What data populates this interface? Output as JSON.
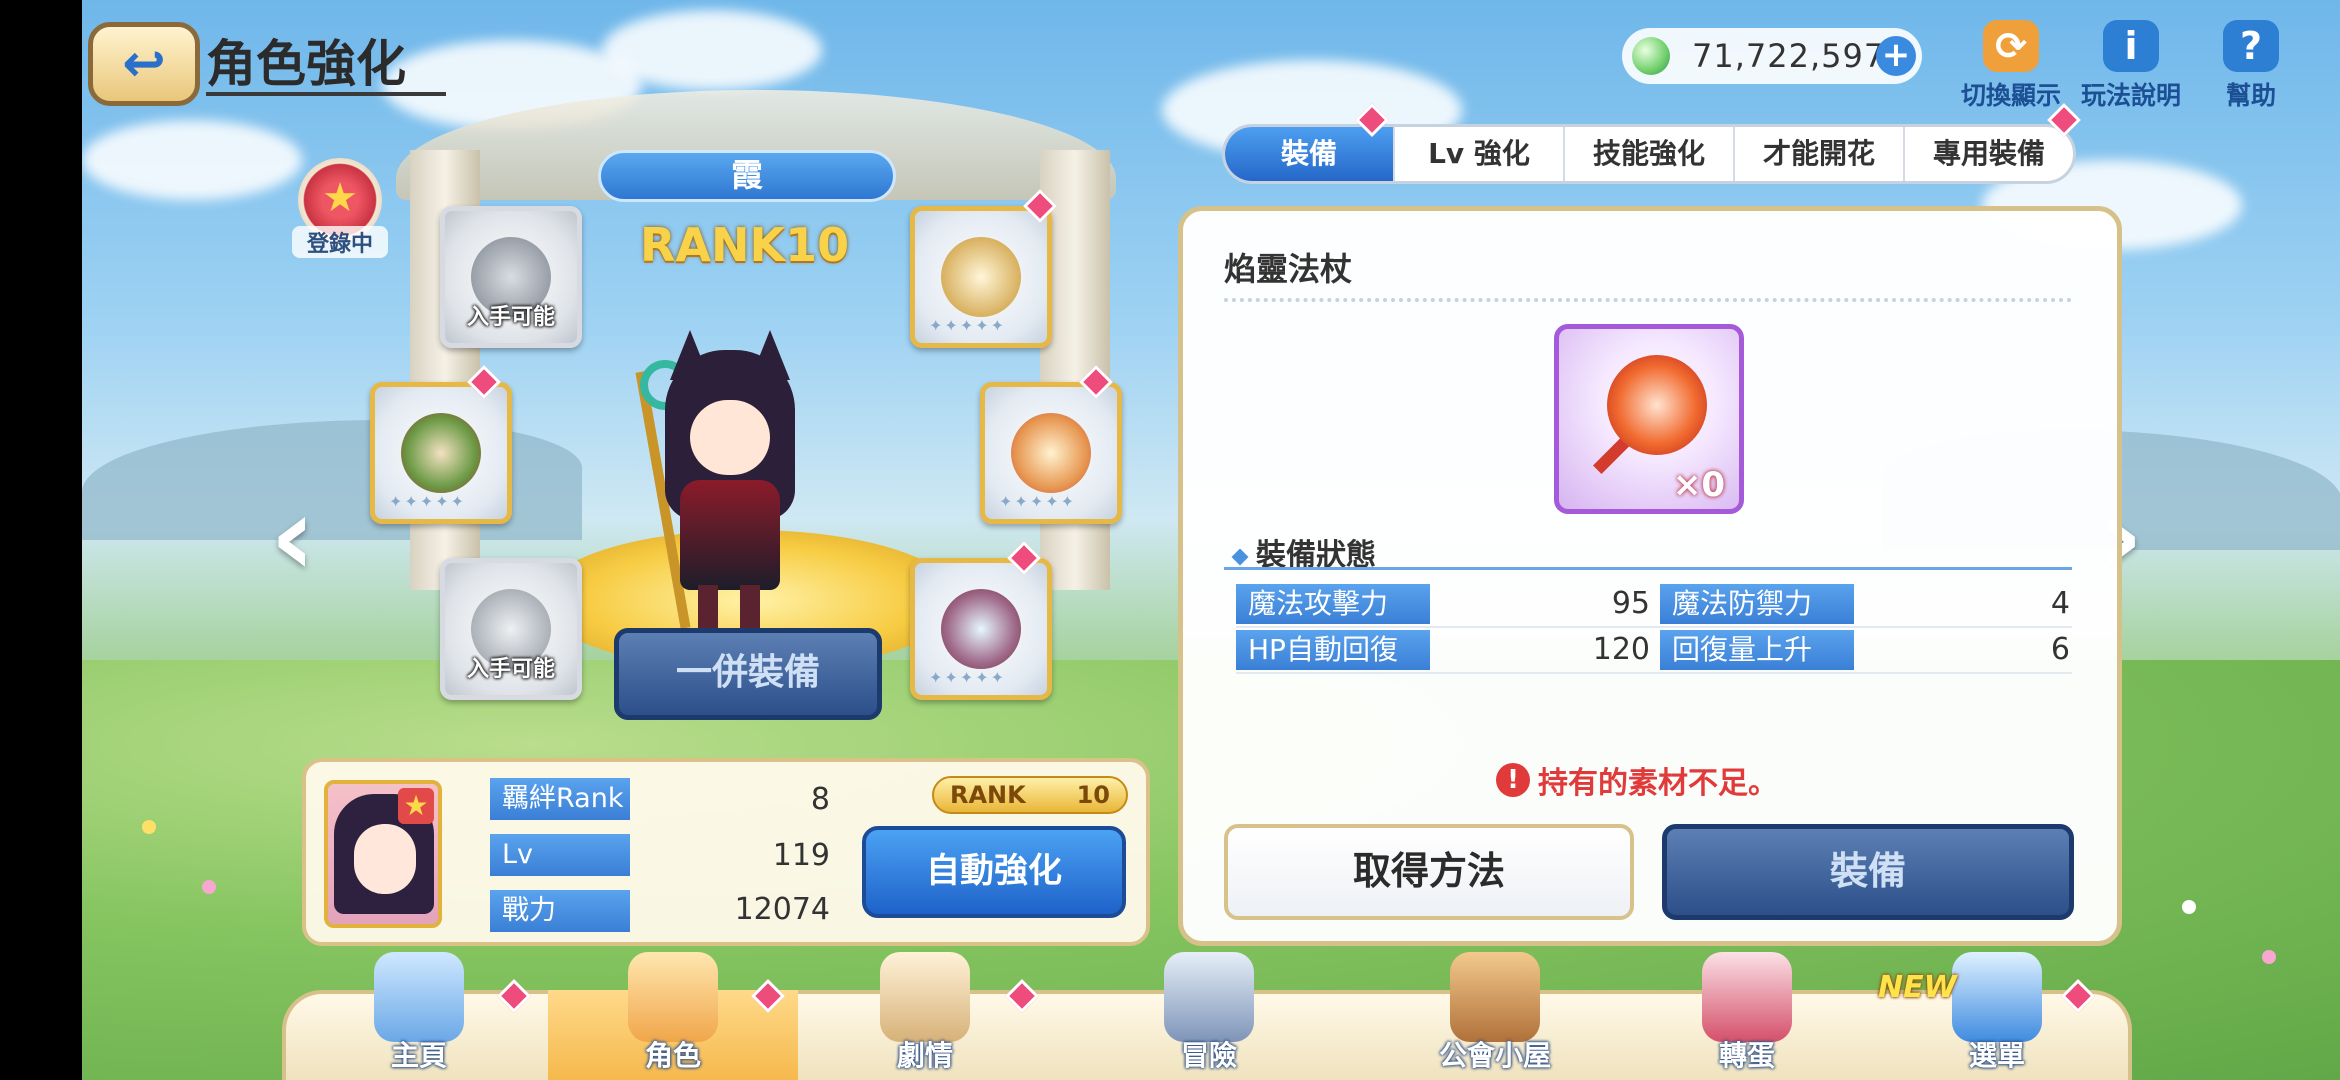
{
  "header": {
    "title": "角色強化",
    "currency": "71,722,597",
    "icons": [
      {
        "name": "switch-display-icon",
        "label": "切換顯示",
        "glyph": "⟳"
      },
      {
        "name": "rules-icon",
        "label": "玩法說明",
        "glyph": "i"
      },
      {
        "name": "help-icon",
        "label": "幫助",
        "glyph": "?"
      }
    ]
  },
  "character": {
    "name": "霞",
    "rank_text": "RANK10",
    "registered_label": "登錄中",
    "slots_available_label": "入手可能",
    "batch_equip_label": "一併裝備",
    "stats": [
      {
        "label": "羈絆Rank",
        "value": "8"
      },
      {
        "label": "Lv",
        "value": "119"
      },
      {
        "label": "戰力",
        "value": "12074"
      }
    ],
    "rank_pill_label": "RANK",
    "rank_pill_value": "10",
    "auto_enhance_label": "自動強化"
  },
  "tabs": [
    {
      "label": "裝備",
      "active": true
    },
    {
      "label": "Lv 強化",
      "active": false
    },
    {
      "label": "技能強化",
      "active": false
    },
    {
      "label": "才能開花",
      "active": false
    },
    {
      "label": "專用裝備",
      "active": false
    }
  ],
  "equipment_detail": {
    "item_name": "焰靈法杖",
    "quantity": "×0",
    "status_heading": "裝備狀態",
    "attributes": [
      {
        "label": "魔法攻擊力",
        "value": "95"
      },
      {
        "label": "魔法防禦力",
        "value": "4"
      },
      {
        "label": "HP自動回復",
        "value": "120"
      },
      {
        "label": "回復量上升",
        "value": "6"
      }
    ],
    "warning": "持有的素材不足。",
    "obtain_label": "取得方法",
    "equip_label": "裝備"
  },
  "bottom_nav": [
    {
      "label": "主頁",
      "active": false
    },
    {
      "label": "角色",
      "active": true
    },
    {
      "label": "劇情",
      "active": false
    },
    {
      "label": "冒險",
      "active": false
    },
    {
      "label": "公會小屋",
      "active": false
    },
    {
      "label": "轉蛋",
      "active": false
    },
    {
      "label": "選單",
      "active": false
    }
  ],
  "new_tag": "NEW",
  "colors": {
    "accent_blue": "#2e77d2",
    "notify_pink": "#ee4c7c",
    "gold_border": "#d6c18a"
  }
}
